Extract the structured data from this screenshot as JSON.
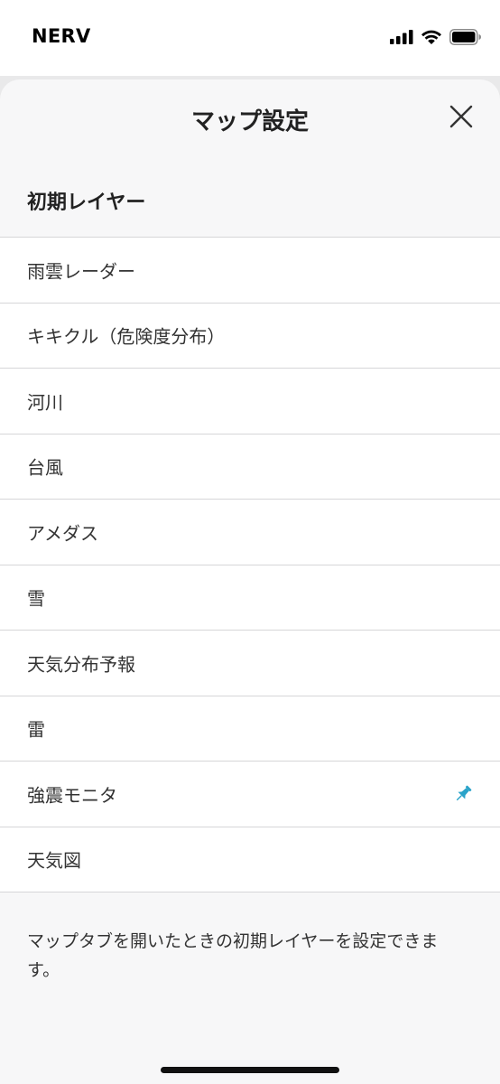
{
  "status_bar": {
    "carrier": "NERV",
    "icons": [
      "cellular-signal-icon",
      "wifi-icon",
      "battery-icon"
    ]
  },
  "sheet": {
    "title": "マップ設定",
    "close_icon": "close-icon"
  },
  "section": {
    "title": "初期レイヤー"
  },
  "layers": [
    {
      "label": "雨雲レーダー",
      "pinned": false
    },
    {
      "label": "キキクル（危険度分布）",
      "pinned": false
    },
    {
      "label": "河川",
      "pinned": false
    },
    {
      "label": "台風",
      "pinned": false
    },
    {
      "label": "アメダス",
      "pinned": false
    },
    {
      "label": "雪",
      "pinned": false
    },
    {
      "label": "天気分布予報",
      "pinned": false
    },
    {
      "label": "雷",
      "pinned": false
    },
    {
      "label": "強震モニタ",
      "pinned": true
    },
    {
      "label": "天気図",
      "pinned": false
    }
  ],
  "footer": {
    "note": "マップタブを開いたときの初期レイヤーを設定できます。"
  },
  "colors": {
    "pin": "#2aa3c9",
    "sheet_background": "#f7f7f8",
    "list_background": "#ffffff",
    "divider": "#d6d6d8"
  }
}
